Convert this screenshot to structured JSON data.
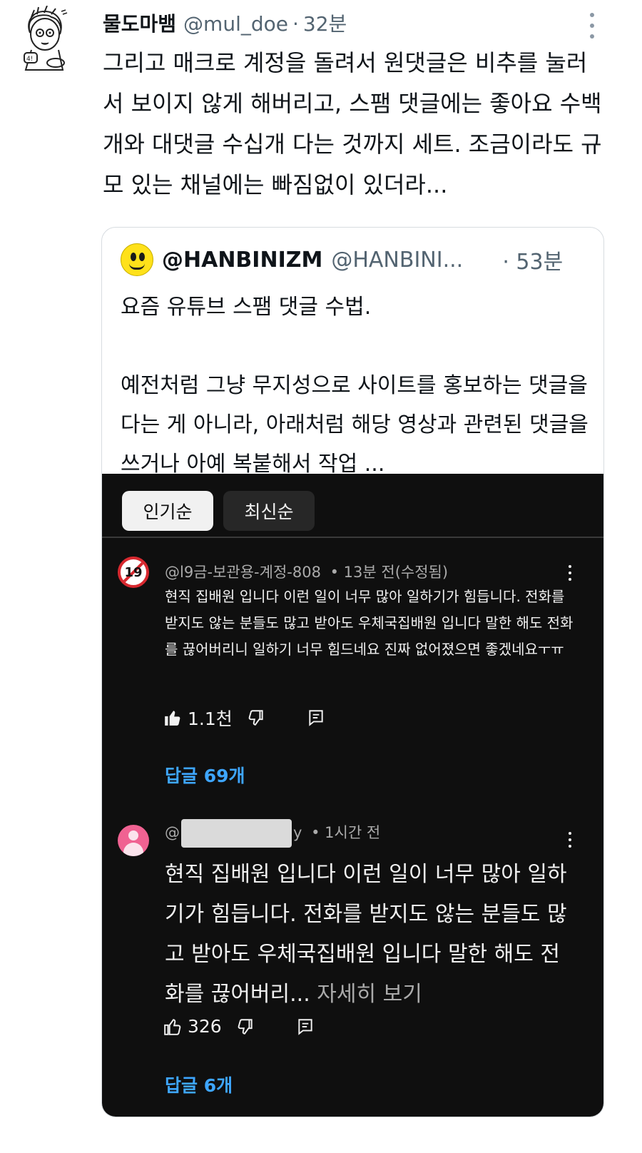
{
  "tweet": {
    "display_name": "물도마뱀",
    "handle": "@mul_doe",
    "separator": "·",
    "time": "32분",
    "text": "그리고 매크로 계정을 돌려서 원댓글은 비추를 눌러서 보이지 않게 해버리고, 스팸 댓글에는 좋아요 수백개와 대댓글 수십개 다는 것까지 세트. 조금이라도 규모 있는 채널에는 빠짐없이 있더라..."
  },
  "quote": {
    "display_name": "@HANBINIZM",
    "handle": "@HANBINI...",
    "time": "· 53분",
    "text": "요즘 유튜브 스팸 댓글 수법.\n\n예전처럼 그냥 무지성으로 사이트를 홍보하는 댓글을 다는 게 아니라, 아래처럼 해당 영상과 관련된 댓글을 쓰거나 아예 복붙해서 작업 ..."
  },
  "youtube": {
    "sort_chips": [
      "인기순",
      "최신순"
    ],
    "comments": [
      {
        "avatar_text": "19",
        "author": "@l9금-보관용-계정-808",
        "time": "• 13분 전(수정됨)",
        "text": "현직 집배원 입니다 이런 일이 너무 많아 일하기가 힘듭니다. 전화를 받지도 않는 분들도 많고 받아도 우체국집배원 입니다 말한 해도 전화를 끊어버리니 일하기 너무 힘드네요 진짜 없어졌으면 좋겠네요ㅜㅠ",
        "likes": "1.1천",
        "replies": "답글 69개"
      },
      {
        "author_prefix": "@",
        "author_suffix": "y",
        "time": "• 1시간 전",
        "text": "현직 집배원 입니다 이런 일이 너무 많아 일하기가 힘듭니다. 전화를 받지도 않는 분들도 많고 받아도 우체국집배원 입니다 말한 해도 전화를 끊어버리...",
        "see_more": "자세히 보기",
        "likes": "326",
        "replies": "답글 6개"
      }
    ]
  },
  "colors": {
    "link_blue": "#3ea6ff",
    "dark_bg": "#0f0f0f",
    "secondary_text": "#536471"
  },
  "icons": [
    "more-vert-icon",
    "thumbs-up-icon",
    "thumbs-down-icon",
    "reply-icon"
  ]
}
